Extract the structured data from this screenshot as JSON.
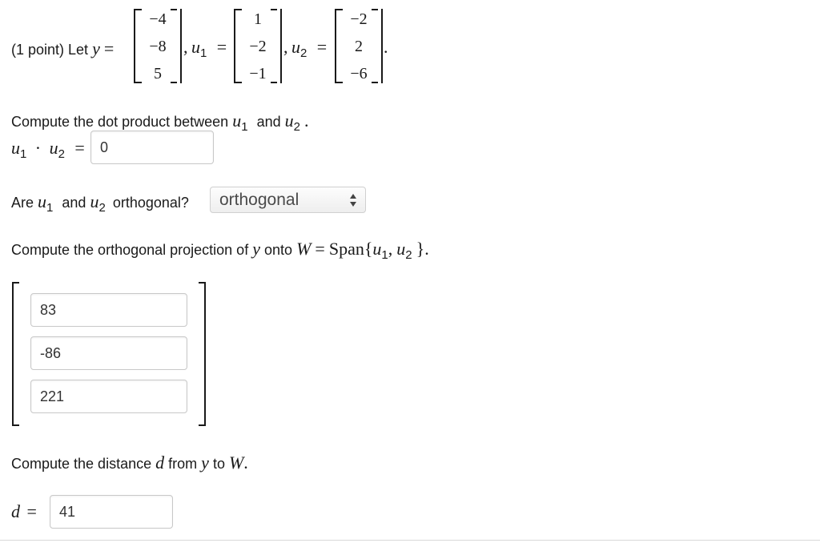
{
  "problem": {
    "intro": "(1 point) Let",
    "y_symbol": "y",
    "u_symbol": "u",
    "sub1": "1",
    "sub2": "2",
    "eq": "=",
    "comma": ",",
    "period": ".",
    "y_vector": [
      "−4",
      "−8",
      "5"
    ],
    "u1_vector": [
      "1",
      "−2",
      "−1"
    ],
    "u2_vector": [
      "−2",
      "2",
      "−6"
    ]
  },
  "q1": {
    "prompt_start": "Compute the dot product between",
    "and": "and",
    "dot": "·",
    "answer": "0"
  },
  "q2": {
    "prompt_start": "Are",
    "and": "and",
    "prompt_end": "orthogonal?",
    "selected": "orthogonal"
  },
  "q3": {
    "prompt_start": "Compute the orthogonal projection of",
    "onto": "onto",
    "W": "W",
    "span": "Span{",
    "close": "}",
    "answers": [
      "83",
      "-86",
      "221"
    ]
  },
  "q4": {
    "prompt_start": "Compute the distance",
    "d": "d",
    "from": "from",
    "to": "to",
    "answer": "41"
  }
}
